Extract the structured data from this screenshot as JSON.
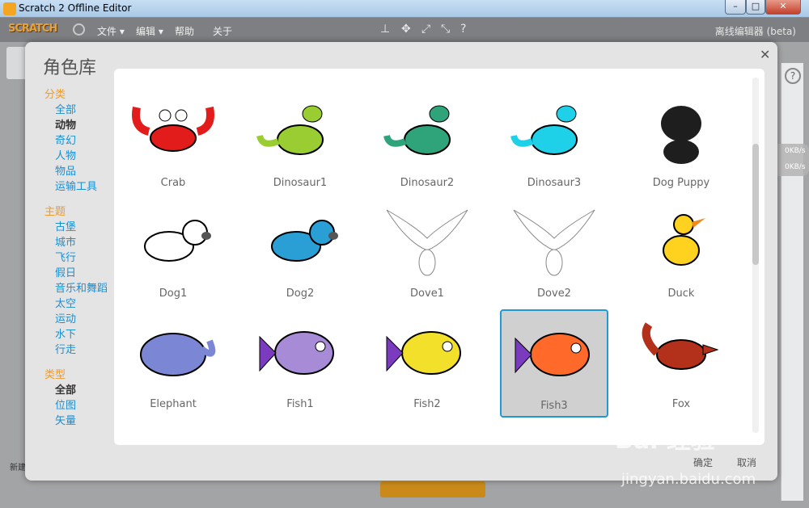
{
  "window": {
    "title": "Scratch 2 Offline Editor",
    "controls": [
      "minimize",
      "maximize",
      "close"
    ]
  },
  "menubar": {
    "logo": "SCRATCH",
    "items": [
      "文件 ▾",
      "编辑 ▾",
      "帮助",
      "关于"
    ],
    "offline_label": "离线编辑器 (beta)"
  },
  "netwidget": {
    "up": "0KB/s",
    "down": "0KB/s"
  },
  "stage": {
    "new_label": "新建"
  },
  "library": {
    "title": "角色库",
    "sections": [
      {
        "heading": "分类",
        "items": [
          "全部",
          "动物",
          "奇幻",
          "人物",
          "物品",
          "运输工具"
        ],
        "active": "动物"
      },
      {
        "heading": "主题",
        "items": [
          "古堡",
          "城市",
          "飞行",
          "假日",
          "音乐和舞蹈",
          "太空",
          "运动",
          "水下",
          "行走"
        ],
        "active": ""
      },
      {
        "heading": "类型",
        "items": [
          "全部",
          "位图",
          "矢量"
        ],
        "active": "全部"
      }
    ],
    "sprites": [
      {
        "name": "Crab",
        "icon": "crab"
      },
      {
        "name": "Dinosaur1",
        "icon": "dinosaur"
      },
      {
        "name": "Dinosaur2",
        "icon": "dinosaur"
      },
      {
        "name": "Dinosaur3",
        "icon": "dinosaur"
      },
      {
        "name": "Dog Puppy",
        "icon": "puppy"
      },
      {
        "name": "Dog1",
        "icon": "dog"
      },
      {
        "name": "Dog2",
        "icon": "dog"
      },
      {
        "name": "Dove1",
        "icon": "dove"
      },
      {
        "name": "Dove2",
        "icon": "dove"
      },
      {
        "name": "Duck",
        "icon": "duck"
      },
      {
        "name": "Elephant",
        "icon": "elephant"
      },
      {
        "name": "Fish1",
        "icon": "fish"
      },
      {
        "name": "Fish2",
        "icon": "fish"
      },
      {
        "name": "Fish3",
        "icon": "fish"
      },
      {
        "name": "Fox",
        "icon": "fox"
      }
    ],
    "selected": "Fish3",
    "ok_label": "确定",
    "cancel_label": "取消"
  },
  "watermark": {
    "logo": "Bai 经验",
    "url": "jingyan.baidu.com"
  },
  "colors": {
    "crab": "#e21b1b",
    "dino1": "#9acd32",
    "dino2": "#2fa37a",
    "dino3": "#1ed0e8",
    "puppy": "#1e1e1e",
    "dog1": "#ffffff",
    "dog2": "#2a9fd6",
    "dove": "#ffffff",
    "duck": "#ffd21f",
    "elephant": "#7b86d4",
    "fish1": "#a78bd6",
    "fish2": "#f2e02a",
    "fish3": "#ff6a2a",
    "fox": "#b3301a",
    "accent": "#1f9ad6",
    "section": "#f09a28",
    "link": "#1a8fd2"
  }
}
